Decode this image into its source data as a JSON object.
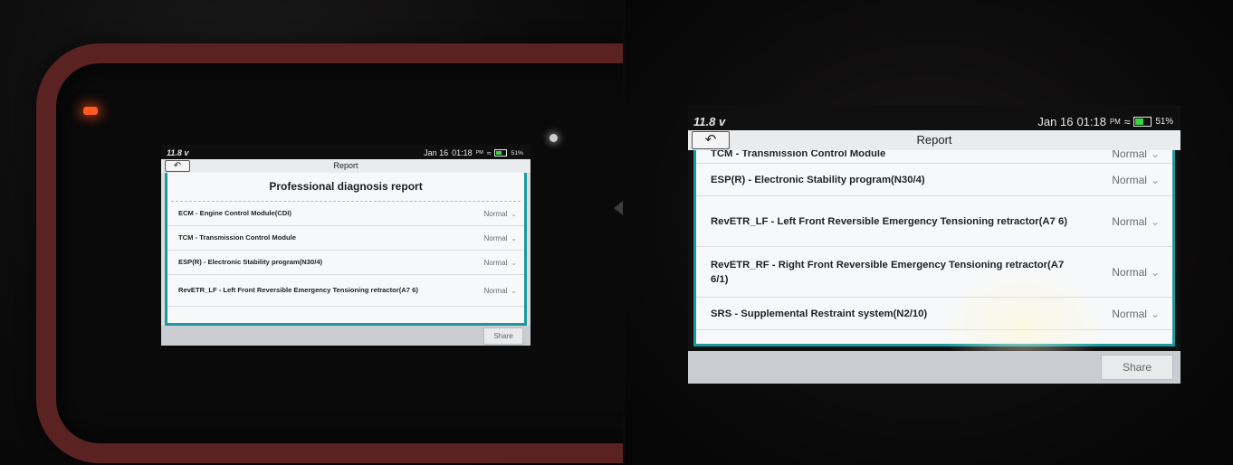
{
  "status_bar": {
    "voltage": "11.8 v",
    "date": "Jan 16",
    "time": "01:18",
    "ampm": "PM",
    "wifi_icon": "wifi-icon",
    "battery": "51%"
  },
  "header": {
    "title": "Report",
    "back_icon": "back-arrow-icon"
  },
  "report": {
    "heading": "Professional diagnosis report",
    "items": [
      {
        "name": "ECM - Engine Control Module(CDI)",
        "status": "Normal"
      },
      {
        "name": "TCM - Transmission Control Module",
        "status": "Normal"
      },
      {
        "name": "ESP(R) - Electronic Stability program(N30/4)",
        "status": "Normal"
      },
      {
        "name": "RevETR_LF - Left Front Reversible Emergency Tensioning retractor(A7 6)",
        "status": "Normal"
      },
      {
        "name": "RevETR_RF - Right Front Reversible Emergency Tensioning retractor(A7 6/1)",
        "status": "Normal"
      },
      {
        "name": "SRS - Supplemental Restraint system(N2/10)",
        "status": "Normal"
      }
    ]
  },
  "footer": {
    "share_label": "Share"
  },
  "colors": {
    "panel_border": "#1a9aa0",
    "battery_fill": "#35d640",
    "casing": "#5a2221"
  }
}
